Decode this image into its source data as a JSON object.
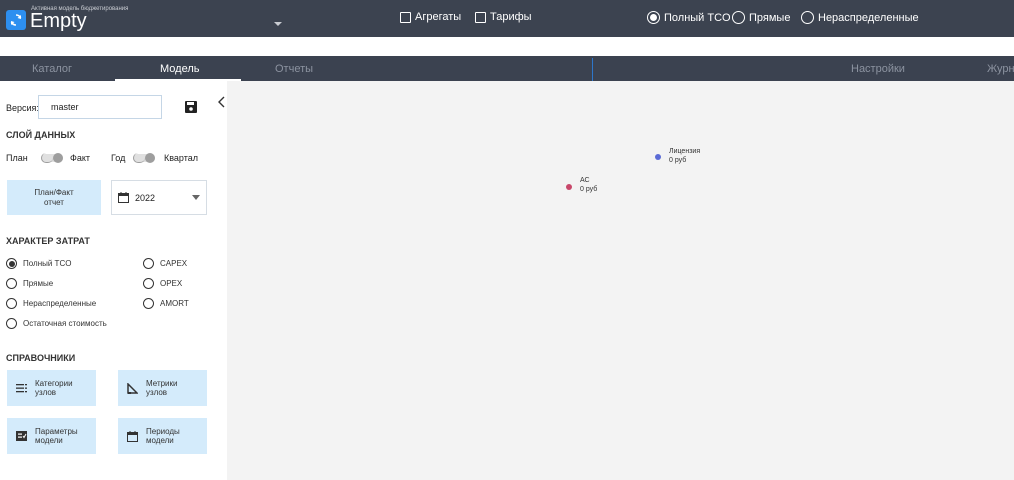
{
  "header": {
    "subtitle": "Активная модель бюджетирования",
    "title": "Empty",
    "checkboxes": [
      {
        "label": "Агрегаты",
        "checked": false
      },
      {
        "label": "Тарифы",
        "checked": false
      }
    ],
    "cost_modes": [
      {
        "label": "Полный TCO",
        "selected": true
      },
      {
        "label": "Прямые",
        "selected": false
      },
      {
        "label": "Нераспределенные",
        "selected": false
      }
    ]
  },
  "tabs": [
    {
      "label": "Каталог",
      "active": false
    },
    {
      "label": "Модель",
      "active": true
    },
    {
      "label": "Отчеты",
      "active": false
    },
    {
      "label": "Настройки",
      "active": false
    },
    {
      "label": "Журна",
      "active": false
    }
  ],
  "sidebar": {
    "version_label": "Версия:",
    "version_value": "master",
    "data_layer_title": "СЛОЙ ДАННЫХ",
    "plan_label": "План",
    "fact_label": "Факт",
    "year_label": "Год",
    "quarter_label": "Квартал",
    "plan_fact_button": "План/Факт\nотчет",
    "year_value": "2022",
    "cost_type_title": "ХАРАКТЕР ЗАТРАТ",
    "cost_types": [
      {
        "label": "Полный TCO",
        "selected": true
      },
      {
        "label": "CAPEX",
        "selected": false
      },
      {
        "label": "Прямые",
        "selected": false
      },
      {
        "label": "OPEX",
        "selected": false
      },
      {
        "label": "Нераспределенные",
        "selected": false
      },
      {
        "label": "AMORT",
        "selected": false
      },
      {
        "label": "Остаточная стоимость",
        "selected": false
      }
    ],
    "references_title": "СПРАВОЧНИКИ",
    "references": [
      {
        "label": "Категории\nузлов",
        "icon": "list-icon"
      },
      {
        "label": "Метрики\nузлов",
        "icon": "ruler-icon"
      },
      {
        "label": "Параметры\nмодели",
        "icon": "settings-list-icon"
      },
      {
        "label": "Периоды\nмодели",
        "icon": "calendar-icon"
      }
    ]
  },
  "graph": {
    "nodes": [
      {
        "name": "Лицензия",
        "value": "0 руб",
        "color": "#5b6bd6"
      },
      {
        "name": "АС",
        "value": "0 руб",
        "color": "#c8476a"
      }
    ]
  },
  "colors": {
    "topbar": "#3c4350",
    "accent": "#2d8ff0",
    "button_bg": "#d4ebfb"
  }
}
